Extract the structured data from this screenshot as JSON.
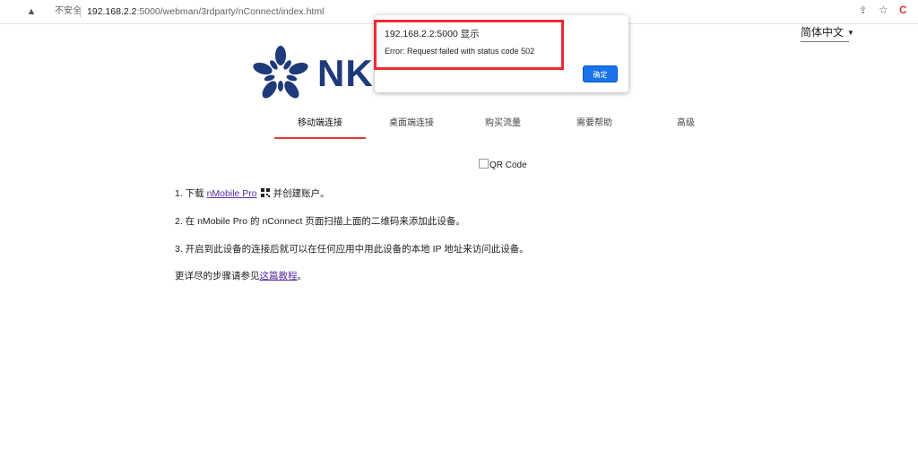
{
  "browser": {
    "security_label": "不安全",
    "url_host": "192.168.2.2",
    "url_rest": ":5000/webman/3rdparty/nConnect/index.html",
    "icons": [
      "warning-icon",
      "share-icon",
      "star-icon",
      "extension-icon"
    ],
    "extension_glyph": "C"
  },
  "language": {
    "selected": "简体中文"
  },
  "logo": {
    "text": "NK",
    "color": "#1f3a7a"
  },
  "tabs": [
    {
      "label": "移动端连接",
      "active": true
    },
    {
      "label": "桌面端连接",
      "active": false
    },
    {
      "label": "购买流量",
      "active": false
    },
    {
      "label": "需要帮助",
      "active": false
    },
    {
      "label": "高级",
      "active": false
    }
  ],
  "qr": {
    "label": "QR Code"
  },
  "steps": {
    "s1_prefix": "1. 下载 ",
    "s1_link": "nMobile Pro",
    "s1_suffix": "并创建账户。",
    "s2": "2. 在 nMobile Pro 的 nConnect 页面扫描上面的二维码来添加此设备。",
    "s3": "3. 开启到此设备的连接后就可以在任何应用中用此设备的本地 IP 地址来访问此设备。",
    "s4_prefix": "更详尽的步骤请参见",
    "s4_link": "这篇教程",
    "s4_suffix": "。"
  },
  "dialog": {
    "title": "192.168.2.2:5000 显示",
    "message": "Error: Request failed with status code 502",
    "ok_label": "确定"
  },
  "colors": {
    "accent_red": "#e03a3a",
    "highlight_red": "#ee2b33",
    "button_blue": "#1a73e8"
  }
}
